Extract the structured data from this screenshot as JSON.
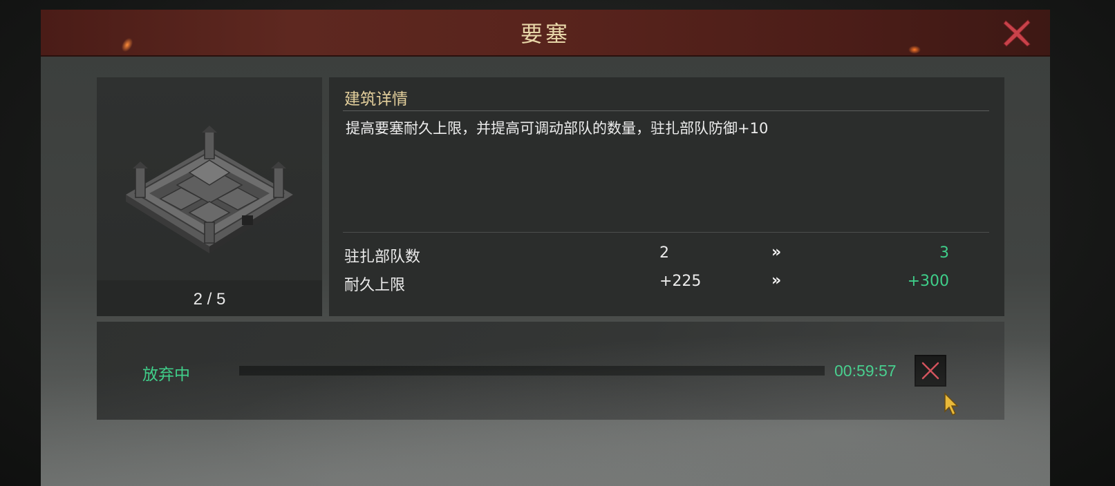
{
  "dialog": {
    "title": "要塞",
    "close_icon": "close-x-icon"
  },
  "building": {
    "image_icon": "fortress-building-image",
    "level_counter": "2 / 5"
  },
  "details": {
    "heading": "建筑详情",
    "description": "提高要塞耐久上限，并提高可调动部队的数量，驻扎部队防御+10",
    "arrow_glyph": "»",
    "stats": [
      {
        "label": "驻扎部队数",
        "current": "2",
        "next": "3"
      },
      {
        "label": "耐久上限",
        "current": "+225",
        "next": "+300"
      }
    ]
  },
  "abandon": {
    "status_label": "放弃中",
    "progress": 1.0,
    "timer": "00:59:57",
    "cancel_icon": "cancel-x-icon"
  },
  "colors": {
    "accent_green": "#3fcf8a",
    "title_gold": "#e7d6a8",
    "close_red": "#c8424a",
    "title_bar_red": "#5e2820"
  }
}
